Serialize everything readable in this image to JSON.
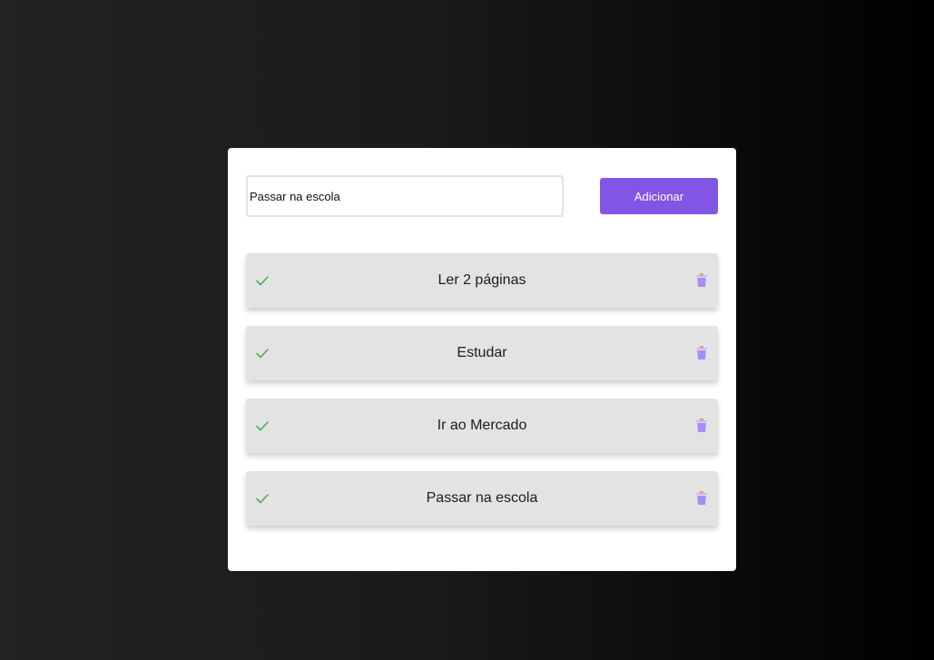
{
  "form": {
    "input_value": "Passar na escola",
    "add_button_label": "Adicionar"
  },
  "tasks": [
    {
      "label": "Ler 2 páginas"
    },
    {
      "label": "Estudar"
    },
    {
      "label": "Ir ao Mercado"
    },
    {
      "label": "Passar na escola"
    }
  ],
  "icons": {
    "complete": "check-icon",
    "delete": "trash-icon"
  },
  "colors": {
    "accent": "#8255e5",
    "check": "#4caf50",
    "trash": "#a78bfa",
    "trash_lid": "#f2994a",
    "item_bg": "#e3e3e3"
  }
}
